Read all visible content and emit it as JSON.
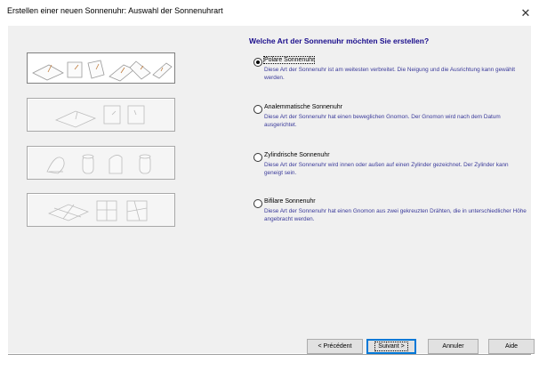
{
  "window": {
    "title": "Erstellen einer neuen Sonnenuhr: Auswahl der Sonnenuhrart",
    "close_glyph": "✕"
  },
  "question": "Welche Art der Sonnenuhr möchten Sie erstellen?",
  "options": [
    {
      "label": "Polare Sonnenuhr",
      "description": "Diese Art der Sonnenuhr ist am weitesten verbreitet. Die Neigung und die Ausrichtung kann gewählt werden.",
      "checked": true,
      "icon": "polar-sundial-icons"
    },
    {
      "label": "Analemmatische Sonnenuhr",
      "description": "Diese Art der Sonnenuhr hat einen beweglichen Gnomon. Der Gnomon wird nach dem Datum ausgerichtet.",
      "checked": false,
      "icon": "analemmatic-sundial-icons"
    },
    {
      "label": "Zylindrische Sonnenuhr",
      "description": "Diese Art der Sonnenuhr wird innen oder außen auf einen Zylinder gezeichnet. Der Zylinder kann geneigt sein.",
      "checked": false,
      "icon": "cylindrical-sundial-icons"
    },
    {
      "label": "Bifilare Sonnenuhr",
      "description": "Diese Art der Sonnenuhr hat einen Gnomon aus zwei gekreuzten Drähten,  die in unterschiedlicher Höhe angebracht werden.",
      "checked": false,
      "icon": "bifilar-sundial-icons"
    }
  ],
  "buttons": {
    "previous": "< Précédent",
    "next": "Suivant >",
    "cancel": "Annuler",
    "help": "Aide"
  },
  "colors": {
    "question_text": "#1a0d8c",
    "description_text": "#3a3a9a",
    "dialog_background": "#f0f0f0",
    "default_button_border": "#0078d7"
  }
}
